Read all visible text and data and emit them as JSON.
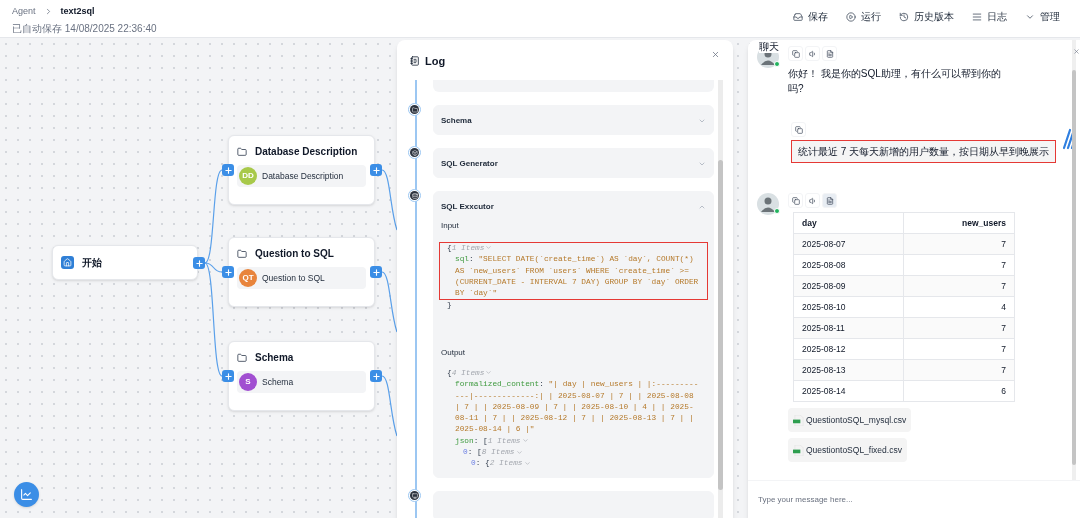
{
  "header": {
    "breadcrumb": [
      {
        "label": "Agent"
      },
      {
        "label": "text2sql"
      }
    ],
    "autosave": "已自动保存 14/08/2025 22:36:40",
    "actions": [
      {
        "kind": "save",
        "label": "保存"
      },
      {
        "kind": "run",
        "label": "运行"
      },
      {
        "kind": "history",
        "label": "历史版本"
      },
      {
        "kind": "log",
        "label": "日志"
      },
      {
        "kind": "manage",
        "label": "管理"
      }
    ]
  },
  "canvas": {
    "start": {
      "title": "开始"
    },
    "nodes": [
      {
        "title": "Database Description",
        "badge": "DD",
        "color": "#a8c94a",
        "sub": "Database Description"
      },
      {
        "title": "Question to SQL",
        "badge": "QT",
        "color": "#e8843c",
        "sub": "Question to SQL"
      },
      {
        "title": "Schema",
        "badge": "S",
        "color": "#a14fd1",
        "sub": "Schema"
      }
    ]
  },
  "log": {
    "title": "Log",
    "steps": [
      {
        "kind": "schema",
        "title": "Schema",
        "expanded": false
      },
      {
        "kind": "generator",
        "title": "SQL Generator",
        "expanded": false
      },
      {
        "kind": "executor",
        "title": "SQL Exxcutor",
        "expanded": true,
        "input_label": "Input",
        "input": {
          "highlighted": true,
          "segs": [
            {
              "kind": "punct",
              "t": "{"
            },
            {
              "kind": "meta",
              "t": "1 Items"
            }
          ],
          "children": [
            {
              "segs": [
                {
                  "kind": "key",
                  "t": "sql"
                },
                {
                  "kind": "punct",
                  "t": ": "
                },
                {
                  "kind": "string",
                  "t": "\"SELECT DATE(`create_time`) AS `day`, COUNT(*) AS `new_users` FROM `users` WHERE `create_time` >= (CURRENT_DATE - INTERVAL 7 DAY) GROUP BY `day` ORDER BY `day`\""
                }
              ]
            }
          ],
          "close": [
            {
              "kind": "punct",
              "t": "}"
            }
          ]
        },
        "output_label": "Output",
        "output": {
          "segs": [
            {
              "kind": "punct",
              "t": "{"
            },
            {
              "kind": "meta",
              "t": "4 Items"
            }
          ],
          "children": [
            {
              "segs": [
                {
                  "kind": "key",
                  "t": "formalized_content"
                },
                {
                  "kind": "punct",
                  "t": ": "
                },
                {
                  "kind": "string",
                  "t": "\"| day | new_users | |:------------|-------------:| | 2025-08-07 | 7 | | 2025-08-08 | 7 | | 2025-08-09 | 7 | | 2025-08-10 | 4 | | 2025-08-11 | 7 | | 2025-08-12 | 7 | | 2025-08-13 | 7 | | 2025-08-14 | 6 |\""
                }
              ]
            },
            {
              "segs": [
                {
                  "kind": "key",
                  "t": "json"
                },
                {
                  "kind": "punct",
                  "t": ": ["
                },
                {
                  "kind": "meta",
                  "t": "1 Items"
                }
              ],
              "children": [
                {
                  "segs": [
                    {
                      "kind": "index",
                      "t": "0"
                    },
                    {
                      "kind": "punct",
                      "t": ": ["
                    },
                    {
                      "kind": "meta",
                      "t": "8 Items"
                    }
                  ],
                  "children": [
                    {
                      "segs": [
                        {
                          "kind": "index",
                          "t": "0"
                        },
                        {
                          "kind": "punct",
                          "t": ": {"
                        },
                        {
                          "kind": "meta",
                          "t": "2 Items"
                        }
                      ]
                    }
                  ]
                }
              ]
            }
          ]
        }
      },
      {
        "kind": "output",
        "expanded": false
      }
    ]
  },
  "chat": {
    "title": "聊天",
    "messages": [
      {
        "kind": "bot",
        "actions": [
          {
            "kind": "copy",
            "selected": false
          },
          {
            "kind": "speaker",
            "selected": false
          },
          {
            "kind": "document",
            "selected": false
          }
        ],
        "text": "你好！ 我是你的SQL助理，有什么可以帮到你的吗?"
      },
      {
        "kind": "user",
        "highlighted": true,
        "actions": [
          {
            "kind": "copy",
            "selected": false
          }
        ],
        "text": "统计最近 7 天每天新增的用户数量，按日期从早到晚展示"
      },
      {
        "kind": "bot",
        "actions": [
          {
            "kind": "copy",
            "selected": false
          },
          {
            "kind": "speaker",
            "selected": false
          },
          {
            "kind": "document",
            "selected": true
          }
        ],
        "table": {
          "columns": [
            {
              "label": "day"
            },
            {
              "label": "new_users"
            }
          ],
          "rows": [
            [
              "2025-08-07",
              "7"
            ],
            [
              "2025-08-08",
              "7"
            ],
            [
              "2025-08-09",
              "7"
            ],
            [
              "2025-08-10",
              "4"
            ],
            [
              "2025-08-11",
              "7"
            ],
            [
              "2025-08-12",
              "7"
            ],
            [
              "2025-08-13",
              "7"
            ],
            [
              "2025-08-14",
              "6"
            ]
          ]
        },
        "files": [
          {
            "name": "QuestiontoSQL_mysql.csv"
          },
          {
            "name": "QuestiontoSQL_fixed.csv"
          }
        ]
      }
    ],
    "input": {
      "placeholder": "Type your message here..."
    }
  }
}
